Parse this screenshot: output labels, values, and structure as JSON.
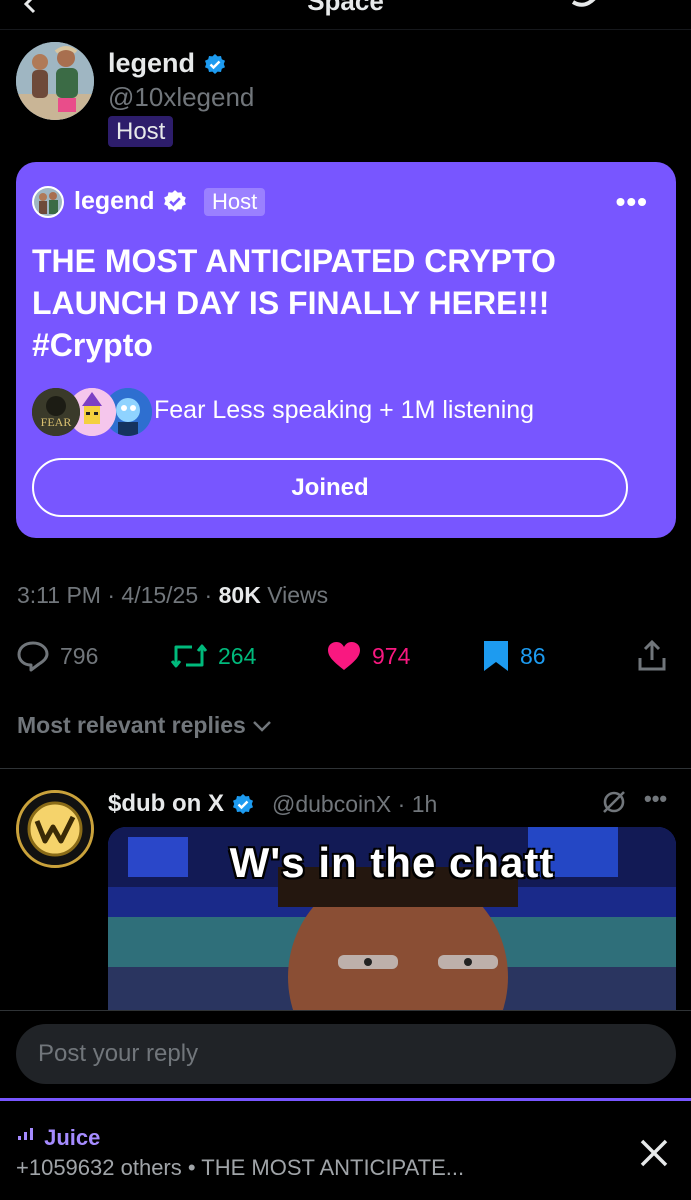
{
  "topbar": {
    "title": "Space"
  },
  "author": {
    "name": "legend",
    "handle": "@10xlegend",
    "role": "Host"
  },
  "space_card": {
    "host_name": "legend",
    "host_role": "Host",
    "title": "THE MOST ANTICIPATED CRYPTO LAUNCH DAY IS FINALLY HERE!!! #Crypto",
    "listening": "Fear Less speaking + 1M listening",
    "join_label": "Joined",
    "speaker_badge": "FEAR",
    "color": "#7856ff"
  },
  "meta": {
    "time": "3:11 PM",
    "date": "4/15/25",
    "views_count": "80K",
    "views_label": "Views"
  },
  "actions": {
    "replies": "796",
    "reposts": "264",
    "likes": "974",
    "bookmarks": "86"
  },
  "sort_label": "Most relevant replies",
  "reply": {
    "name": "$dub on X",
    "handle": "@dubcoinX",
    "time": "1h",
    "gif_caption": "W's in the chatt"
  },
  "composer": {
    "placeholder": "Post your reply"
  },
  "mini_player": {
    "title": "Juice",
    "subtitle": "+1059632 others • THE MOST ANTICIPATE..."
  },
  "colors": {
    "repost": "#00ba7c",
    "like": "#f91880",
    "bookmark": "#1d9bf0",
    "verified": "#1d9bf0"
  },
  "icons": [
    "back-icon",
    "grok-icon",
    "verified-icon",
    "more-icon",
    "reply-icon",
    "repost-icon",
    "heart-icon",
    "bookmark-icon",
    "share-icon",
    "chevron-down-icon",
    "audio-wave-icon",
    "close-icon"
  ]
}
